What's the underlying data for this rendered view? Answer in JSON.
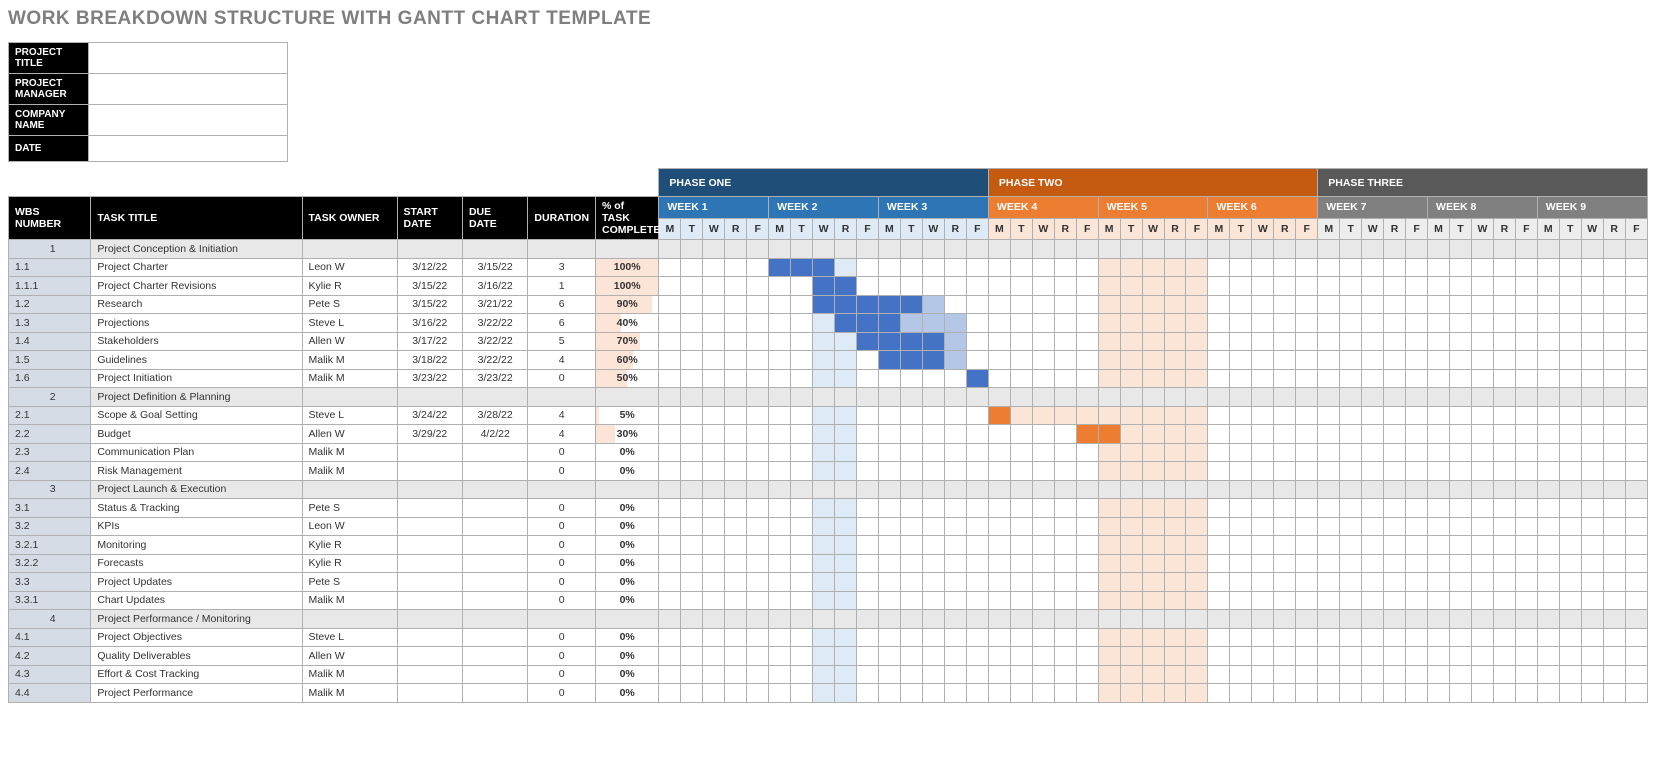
{
  "title": "WORK BREAKDOWN STRUCTURE WITH GANTT CHART TEMPLATE",
  "meta_labels": [
    "PROJECT TITLE",
    "PROJECT MANAGER",
    "COMPANY NAME",
    "DATE"
  ],
  "meta_values": [
    "",
    "",
    "",
    ""
  ],
  "columns": {
    "wbs": "WBS NUMBER",
    "title": "TASK TITLE",
    "owner": "TASK OWNER",
    "start": "START DATE",
    "due": "DUE DATE",
    "dur": "DURATION",
    "pct": "% of TASK COMPLETE"
  },
  "phases": [
    {
      "label": "PHASE ONE",
      "cls": "ph1",
      "weeks": [
        1,
        2,
        3
      ]
    },
    {
      "label": "PHASE TWO",
      "cls": "ph2",
      "weeks": [
        4,
        5,
        6
      ]
    },
    {
      "label": "PHASE THREE",
      "cls": "ph3",
      "weeks": [
        7,
        8,
        9
      ]
    }
  ],
  "week_prefix": "WEEK ",
  "days": [
    "M",
    "T",
    "W",
    "R",
    "F"
  ],
  "rows": [
    {
      "wbs": "1",
      "title": "Project Conception & Initiation",
      "section": true
    },
    {
      "wbs": "1.1",
      "title": "Project Charter",
      "owner": "Leon W",
      "start": "3/12/22",
      "due": "3/15/22",
      "dur": "3",
      "pct": 100,
      "gantt": [
        [
          5,
          3,
          "b"
        ]
      ]
    },
    {
      "wbs": "1.1.1",
      "title": "Project Charter Revisions",
      "owner": "Kylie R",
      "start": "3/15/22",
      "due": "3/16/22",
      "dur": "1",
      "pct": 100,
      "gantt": [
        [
          7,
          2,
          "b"
        ]
      ]
    },
    {
      "wbs": "1.2",
      "title": "Research",
      "owner": "Pete S",
      "start": "3/15/22",
      "due": "3/21/22",
      "dur": "6",
      "pct": 90,
      "gantt": [
        [
          7,
          5,
          "b"
        ],
        [
          12,
          1,
          "bl"
        ]
      ]
    },
    {
      "wbs": "1.3",
      "title": "Projections",
      "owner": "Steve L",
      "start": "3/16/22",
      "due": "3/22/22",
      "dur": "6",
      "pct": 40,
      "gantt": [
        [
          8,
          3,
          "b"
        ],
        [
          11,
          3,
          "bl"
        ]
      ]
    },
    {
      "wbs": "1.4",
      "title": "Stakeholders",
      "owner": "Allen W",
      "start": "3/17/22",
      "due": "3/22/22",
      "dur": "5",
      "pct": 70,
      "gantt": [
        [
          9,
          4,
          "b"
        ],
        [
          13,
          1,
          "bl"
        ]
      ]
    },
    {
      "wbs": "1.5",
      "title": "Guidelines",
      "owner": "Malik M",
      "start": "3/18/22",
      "due": "3/22/22",
      "dur": "4",
      "pct": 60,
      "gantt": [
        [
          10,
          3,
          "b"
        ],
        [
          13,
          1,
          "bl"
        ]
      ]
    },
    {
      "wbs": "1.6",
      "title": "Project Initiation",
      "owner": "Malik M",
      "start": "3/23/22",
      "due": "3/23/22",
      "dur": "0",
      "pct": 50,
      "gantt": [
        [
          14,
          1,
          "b"
        ]
      ]
    },
    {
      "wbs": "2",
      "title": "Project Definition & Planning",
      "section": true
    },
    {
      "wbs": "2.1",
      "title": "Scope & Goal Setting",
      "owner": "Steve L",
      "start": "3/24/22",
      "due": "3/28/22",
      "dur": "4",
      "pct": 5,
      "gantt": [
        [
          15,
          1,
          "o"
        ],
        [
          16,
          4,
          "ol"
        ]
      ]
    },
    {
      "wbs": "2.2",
      "title": "Budget",
      "owner": "Allen W",
      "start": "3/29/22",
      "due": "4/2/22",
      "dur": "4",
      "pct": 30,
      "gantt": [
        [
          19,
          2,
          "o"
        ],
        [
          21,
          3,
          "ol"
        ]
      ]
    },
    {
      "wbs": "2.3",
      "title": "Communication Plan",
      "owner": "Malik M",
      "start": "",
      "due": "",
      "dur": "0",
      "pct": 0
    },
    {
      "wbs": "2.4",
      "title": "Risk Management",
      "owner": "Malik M",
      "start": "",
      "due": "",
      "dur": "0",
      "pct": 0
    },
    {
      "wbs": "3",
      "title": "Project Launch & Execution",
      "section": true
    },
    {
      "wbs": "3.1",
      "title": "Status & Tracking",
      "owner": "Pete S",
      "start": "",
      "due": "",
      "dur": "0",
      "pct": 0
    },
    {
      "wbs": "3.2",
      "title": "KPIs",
      "owner": "Leon W",
      "start": "",
      "due": "",
      "dur": "0",
      "pct": 0
    },
    {
      "wbs": "3.2.1",
      "title": "Monitoring",
      "owner": "Kylie R",
      "start": "",
      "due": "",
      "dur": "0",
      "pct": 0
    },
    {
      "wbs": "3.2.2",
      "title": "Forecasts",
      "owner": "Kylie R",
      "start": "",
      "due": "",
      "dur": "0",
      "pct": 0
    },
    {
      "wbs": "3.3",
      "title": "Project Updates",
      "owner": "Pete S",
      "start": "",
      "due": "",
      "dur": "0",
      "pct": 0
    },
    {
      "wbs": "3.3.1",
      "title": "Chart Updates",
      "owner": "Malik M",
      "start": "",
      "due": "",
      "dur": "0",
      "pct": 0
    },
    {
      "wbs": "4",
      "title": "Project Performance / Monitoring",
      "section": true
    },
    {
      "wbs": "4.1",
      "title": "Project Objectives",
      "owner": "Steve L",
      "start": "",
      "due": "",
      "dur": "0",
      "pct": 0
    },
    {
      "wbs": "4.2",
      "title": "Quality Deliverables",
      "owner": "Allen W",
      "start": "",
      "due": "",
      "dur": "0",
      "pct": 0
    },
    {
      "wbs": "4.3",
      "title": "Effort & Cost Tracking",
      "owner": "Malik M",
      "start": "",
      "due": "",
      "dur": "0",
      "pct": 0
    },
    {
      "wbs": "4.4",
      "title": "Project Performance",
      "owner": "Malik M",
      "start": "",
      "due": "",
      "dur": "0",
      "pct": 0
    }
  ],
  "chart_data": {
    "type": "table",
    "title": "Work Breakdown Structure with Gantt Chart",
    "columns": [
      "WBS NUMBER",
      "TASK TITLE",
      "TASK OWNER",
      "START DATE",
      "DUE DATE",
      "DURATION",
      "% of TASK COMPLETE"
    ],
    "timeline": {
      "unit": "weekday",
      "start_week": 1,
      "weeks": 9,
      "days_per_week": 5,
      "phases": [
        "PHASE ONE (W1-3)",
        "PHASE TWO (W4-6)",
        "PHASE THREE (W7-9)"
      ]
    },
    "rows": [
      [
        "1",
        "Project Conception & Initiation",
        "",
        "",
        "",
        "",
        ""
      ],
      [
        "1.1",
        "Project Charter",
        "Leon W",
        "3/12/22",
        "3/15/22",
        3,
        "100%"
      ],
      [
        "1.1.1",
        "Project Charter Revisions",
        "Kylie R",
        "3/15/22",
        "3/16/22",
        1,
        "100%"
      ],
      [
        "1.2",
        "Research",
        "Pete S",
        "3/15/22",
        "3/21/22",
        6,
        "90%"
      ],
      [
        "1.3",
        "Projections",
        "Steve L",
        "3/16/22",
        "3/22/22",
        6,
        "40%"
      ],
      [
        "1.4",
        "Stakeholders",
        "Allen W",
        "3/17/22",
        "3/22/22",
        5,
        "70%"
      ],
      [
        "1.5",
        "Guidelines",
        "Malik M",
        "3/18/22",
        "3/22/22",
        4,
        "60%"
      ],
      [
        "1.6",
        "Project Initiation",
        "Malik M",
        "3/23/22",
        "3/23/22",
        0,
        "50%"
      ],
      [
        "2",
        "Project Definition & Planning",
        "",
        "",
        "",
        "",
        ""
      ],
      [
        "2.1",
        "Scope & Goal Setting",
        "Steve L",
        "3/24/22",
        "3/28/22",
        4,
        "5%"
      ],
      [
        "2.2",
        "Budget",
        "Allen W",
        "3/29/22",
        "4/2/22",
        4,
        "30%"
      ],
      [
        "2.3",
        "Communication Plan",
        "Malik M",
        "",
        "",
        0,
        "0%"
      ],
      [
        "2.4",
        "Risk Management",
        "Malik M",
        "",
        "",
        0,
        "0%"
      ],
      [
        "3",
        "Project Launch & Execution",
        "",
        "",
        "",
        "",
        ""
      ],
      [
        "3.1",
        "Status & Tracking",
        "Pete S",
        "",
        "",
        0,
        "0%"
      ],
      [
        "3.2",
        "KPIs",
        "Leon W",
        "",
        "",
        0,
        "0%"
      ],
      [
        "3.2.1",
        "Monitoring",
        "Kylie R",
        "",
        "",
        0,
        "0%"
      ],
      [
        "3.2.2",
        "Forecasts",
        "Kylie R",
        "",
        "",
        0,
        "0%"
      ],
      [
        "3.3",
        "Project Updates",
        "Pete S",
        "",
        "",
        0,
        "0%"
      ],
      [
        "3.3.1",
        "Chart Updates",
        "Malik M",
        "",
        "",
        0,
        "0%"
      ],
      [
        "4",
        "Project Performance / Monitoring",
        "",
        "",
        "",
        "",
        ""
      ],
      [
        "4.1",
        "Project Objectives",
        "Steve L",
        "",
        "",
        0,
        "0%"
      ],
      [
        "4.2",
        "Quality Deliverables",
        "Allen W",
        "",
        "",
        0,
        "0%"
      ],
      [
        "4.3",
        "Effort & Cost Tracking",
        "Malik M",
        "",
        "",
        0,
        "0%"
      ],
      [
        "4.4",
        "Project Performance",
        "Malik M",
        "",
        "",
        0,
        "0%"
      ]
    ]
  }
}
